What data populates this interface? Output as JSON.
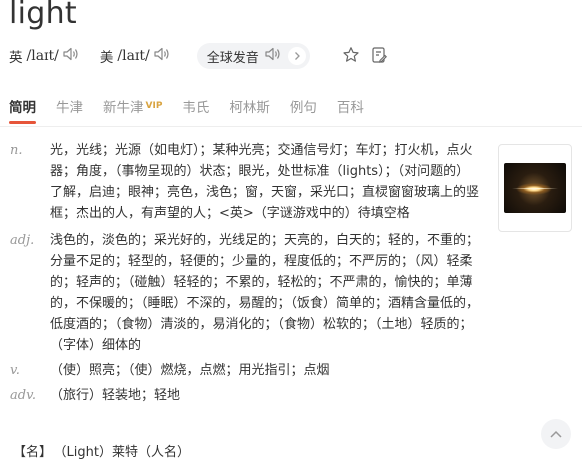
{
  "word": "light",
  "pronunciation": {
    "uk": {
      "label": "英",
      "ipa": "/laɪt/"
    },
    "us": {
      "label": "美",
      "ipa": "/laɪt/"
    },
    "global_label": "全球发音"
  },
  "tabs": [
    {
      "label": "简明",
      "active": true
    },
    {
      "label": "牛津",
      "active": false
    },
    {
      "label": "新牛津",
      "badge": "VIP",
      "active": false
    },
    {
      "label": "韦氏",
      "active": false
    },
    {
      "label": "柯林斯",
      "active": false
    },
    {
      "label": "例句",
      "active": false
    },
    {
      "label": "百科",
      "active": false
    }
  ],
  "definitions": [
    {
      "pos": "n.",
      "text": "光，光线；光源（如电灯）；某种光亮；交通信号灯；车灯；打火机，点火器；角度，（事物呈现的）状态；眼光，处世标准（lights）；（对问题的）了解，启迪；眼神；亮色，浅色；窗，天窗，采光口；直棂窗窗玻璃上的竖框；杰出的人，有声望的人；<英>（字谜游戏中的）待填空格"
    },
    {
      "pos": "adj.",
      "text": "浅色的，淡色的；采光好的，光线足的；天亮的，白天的；轻的，不重的；分量不足的；轻型的，轻便的；少量的，程度低的；不严厉的；（风）轻柔的；轻声的；（碰触）轻轻的；不累的，轻松的；不严肃的，愉快的；单薄的，不保暖的；（睡眠）不深的，易醒的；（饭食）简单的；酒精含量低的，低度酒的；（食物）清淡的，易消化的；（食物）松软的；（土地）轻质的；（字体）细体的"
    },
    {
      "pos": "v.",
      "text": "（使）照亮；（使）燃烧，点燃；用光指引；点烟"
    },
    {
      "pos": "adv.",
      "text": "（旅行）轻装地；轻地"
    }
  ],
  "name_line": {
    "tag": "【名】",
    "text": "（Light）莱特（人名）"
  },
  "icons": {
    "speaker": "speaker-icon",
    "star": "star-icon",
    "note": "note-icon",
    "top": "back-to-top-icon"
  },
  "colors": {
    "accent": "#e6553a",
    "vip": "#d9a441",
    "muted": "#999999"
  }
}
